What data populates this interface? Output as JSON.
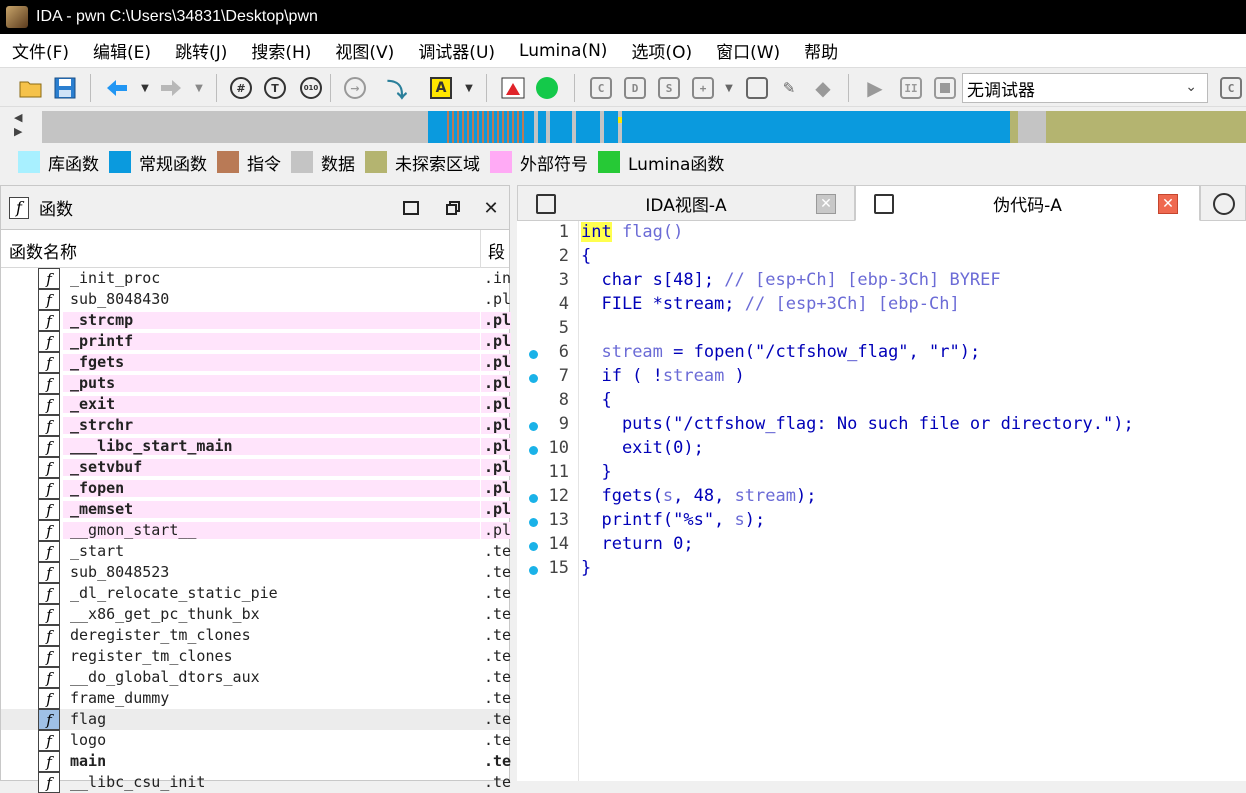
{
  "window": {
    "title": "IDA - pwn C:\\Users\\34831\\Desktop\\pwn"
  },
  "menu": [
    "文件(F)",
    "编辑(E)",
    "跳转(J)",
    "搜索(H)",
    "视图(V)",
    "调试器(U)",
    "Lumina(N)",
    "选项(O)",
    "窗口(W)",
    "帮助"
  ],
  "toolbar": {
    "debugger_value": "无调试器",
    "icons": [
      "open-folder-icon",
      "save-icon",
      "back-arrow-icon",
      "forward-arrow-icon",
      "hex-view-icon",
      "text-view-icon",
      "binary-view-icon",
      "jump-icon",
      "step-icon",
      "highlight-text-icon",
      "segments-icon",
      "run-green-icon",
      "copy-icon",
      "paste-icon",
      "struct-icon",
      "add-struct-icon",
      "frame-icon",
      "edit-icon",
      "diamond-icon",
      "play-icon",
      "pause-icon",
      "stop-icon",
      "attach-icon"
    ],
    "accent": "#0a9ade"
  },
  "legend": [
    {
      "label": "库函数",
      "color": "#a8f0ff"
    },
    {
      "label": "常规函数",
      "color": "#0a9ade"
    },
    {
      "label": "指令",
      "color": "#b97a56"
    },
    {
      "label": "数据",
      "color": "#c4c4c4"
    },
    {
      "label": "未探索区域",
      "color": "#b4b470"
    },
    {
      "label": "外部符号",
      "color": "#ffaaf5"
    },
    {
      "label": "Lumina函数",
      "color": "#26c936"
    }
  ],
  "functions_panel": {
    "title": "函数",
    "col_name": "函数名称",
    "col_segment": "段",
    "rows": [
      {
        "name": "_init_proc",
        "seg": ".init",
        "style": "normal"
      },
      {
        "name": "sub_8048430",
        "seg": ".plt",
        "style": "normal"
      },
      {
        "name": "_strcmp",
        "seg": ".plt",
        "style": "ext-bold"
      },
      {
        "name": "_printf",
        "seg": ".plt",
        "style": "ext-bold"
      },
      {
        "name": "_fgets",
        "seg": ".plt",
        "style": "ext-bold"
      },
      {
        "name": "_puts",
        "seg": ".plt",
        "style": "ext-bold"
      },
      {
        "name": "_exit",
        "seg": ".plt",
        "style": "ext-bold"
      },
      {
        "name": "_strchr",
        "seg": ".plt",
        "style": "ext-bold"
      },
      {
        "name": "___libc_start_main",
        "seg": ".plt",
        "style": "ext-bold"
      },
      {
        "name": "_setvbuf",
        "seg": ".plt",
        "style": "ext-bold"
      },
      {
        "name": "_fopen",
        "seg": ".plt",
        "style": "ext-bold"
      },
      {
        "name": "_memset",
        "seg": ".plt",
        "style": "ext-bold"
      },
      {
        "name": "__gmon_start__",
        "seg": ".plt",
        "style": "ext"
      },
      {
        "name": "_start",
        "seg": ".text",
        "style": "normal"
      },
      {
        "name": "sub_8048523",
        "seg": ".text",
        "style": "normal"
      },
      {
        "name": "_dl_relocate_static_pie",
        "seg": ".text",
        "style": "normal"
      },
      {
        "name": "__x86_get_pc_thunk_bx",
        "seg": ".text",
        "style": "normal"
      },
      {
        "name": "deregister_tm_clones",
        "seg": ".text",
        "style": "normal"
      },
      {
        "name": "register_tm_clones",
        "seg": ".text",
        "style": "normal"
      },
      {
        "name": "__do_global_dtors_aux",
        "seg": ".text",
        "style": "normal"
      },
      {
        "name": "frame_dummy",
        "seg": ".text",
        "style": "normal"
      },
      {
        "name": "flag",
        "seg": ".text",
        "style": "selected"
      },
      {
        "name": "logo",
        "seg": ".text",
        "style": "normal"
      },
      {
        "name": "main",
        "seg": ".text",
        "style": "bold"
      },
      {
        "name": "__libc_csu_init",
        "seg": ".text",
        "style": "normal"
      }
    ]
  },
  "tabs": [
    {
      "label": "IDA视图-A"
    },
    {
      "label": "伪代码-A"
    }
  ],
  "pseudocode": {
    "lines": [
      {
        "n": "1",
        "bp": false,
        "tokens": [
          [
            "int",
            "hl"
          ],
          [
            " flag()",
            "var"
          ]
        ]
      },
      {
        "n": "2",
        "bp": false,
        "tokens": [
          [
            "{",
            "plain"
          ]
        ]
      },
      {
        "n": "3",
        "bp": false,
        "tokens": [
          [
            "  char s[48]; ",
            "plain"
          ],
          [
            "// [esp+Ch] [ebp-3Ch] BYREF",
            "cm"
          ]
        ]
      },
      {
        "n": "4",
        "bp": false,
        "tokens": [
          [
            "  FILE *stream; ",
            "plain"
          ],
          [
            "// [esp+3Ch] [ebp-Ch]",
            "cm"
          ]
        ]
      },
      {
        "n": "5",
        "bp": false,
        "tokens": []
      },
      {
        "n": "6",
        "bp": true,
        "tokens": [
          [
            "  ",
            "plain"
          ],
          [
            "stream",
            "var"
          ],
          [
            " = fopen(\"/ctfshow_flag\", \"r\");",
            "plain"
          ]
        ]
      },
      {
        "n": "7",
        "bp": true,
        "tokens": [
          [
            "  if ( !",
            "plain"
          ],
          [
            "stream",
            "var"
          ],
          [
            " )",
            "plain"
          ]
        ]
      },
      {
        "n": "8",
        "bp": false,
        "tokens": [
          [
            "  {",
            "plain"
          ]
        ]
      },
      {
        "n": "9",
        "bp": true,
        "tokens": [
          [
            "    puts(\"/ctfshow_flag: No such file or directory.\");",
            "plain"
          ]
        ]
      },
      {
        "n": "10",
        "bp": true,
        "tokens": [
          [
            "    exit(0);",
            "plain"
          ]
        ]
      },
      {
        "n": "11",
        "bp": false,
        "tokens": [
          [
            "  }",
            "plain"
          ]
        ]
      },
      {
        "n": "12",
        "bp": true,
        "tokens": [
          [
            "  fgets(",
            "plain"
          ],
          [
            "s",
            "var"
          ],
          [
            ", 48, ",
            "plain"
          ],
          [
            "stream",
            "var"
          ],
          [
            ");",
            "plain"
          ]
        ]
      },
      {
        "n": "13",
        "bp": true,
        "tokens": [
          [
            "  printf(\"%s\", ",
            "plain"
          ],
          [
            "s",
            "var"
          ],
          [
            ");",
            "plain"
          ]
        ]
      },
      {
        "n": "14",
        "bp": true,
        "tokens": [
          [
            "  return 0;",
            "plain"
          ]
        ]
      },
      {
        "n": "15",
        "bp": true,
        "tokens": [
          [
            "}",
            "plain"
          ]
        ]
      }
    ]
  }
}
